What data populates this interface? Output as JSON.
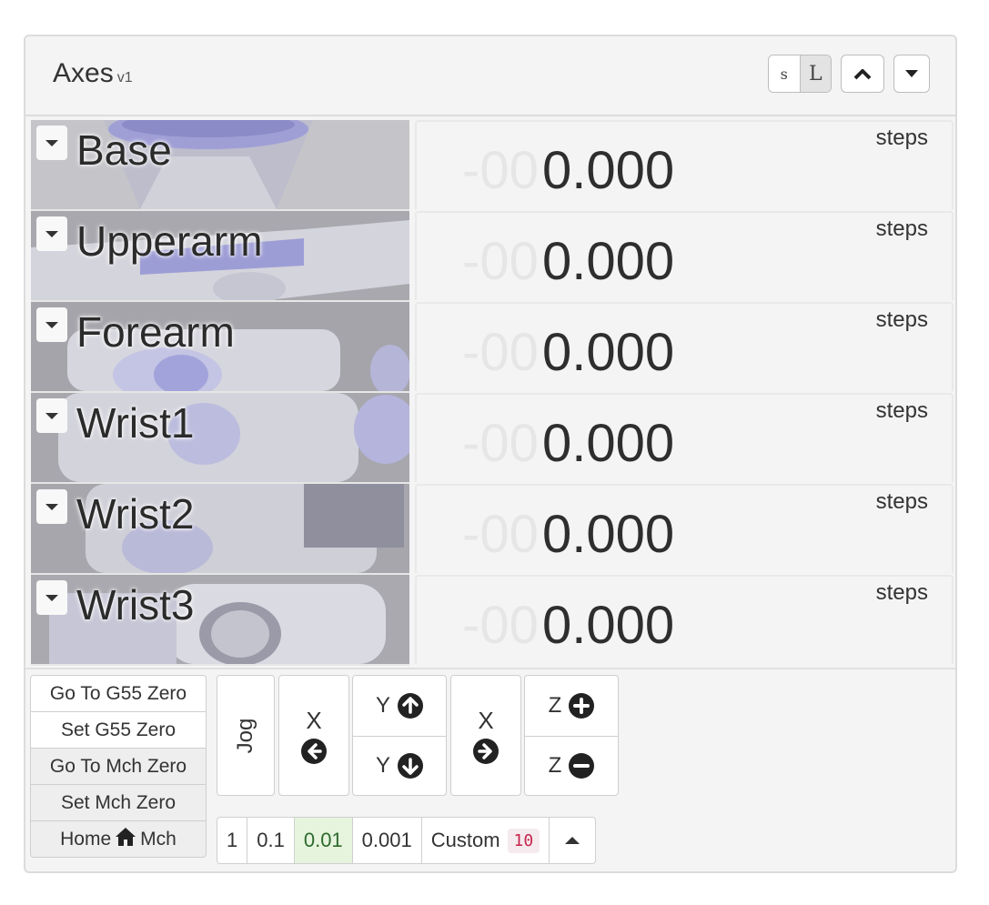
{
  "panel": {
    "title": "Axes",
    "version": "v1",
    "size_small": "s",
    "size_large": "L"
  },
  "axes": [
    {
      "name": "Base",
      "ghost": "-00",
      "value": "0.000",
      "unit": "steps"
    },
    {
      "name": "Upperarm",
      "ghost": "-00",
      "value": "0.000",
      "unit": "steps"
    },
    {
      "name": "Forearm",
      "ghost": "-00",
      "value": "0.000",
      "unit": "steps"
    },
    {
      "name": "Wrist1",
      "ghost": "-00",
      "value": "0.000",
      "unit": "steps"
    },
    {
      "name": "Wrist2",
      "ghost": "-00",
      "value": "0.000",
      "unit": "steps"
    },
    {
      "name": "Wrist3",
      "ghost": "-00",
      "value": "0.000",
      "unit": "steps"
    }
  ],
  "zero_buttons": {
    "goto_g55": "Go To G55 Zero",
    "set_g55": "Set G55 Zero",
    "goto_mch": "Go To Mch Zero",
    "set_mch": "Set Mch Zero",
    "home_prefix": "Home",
    "home_suffix": "Mch"
  },
  "jog": {
    "label": "Jog",
    "x": "X",
    "y": "Y",
    "z": "Z"
  },
  "steps": {
    "options": [
      "1",
      "0.1",
      "0.01",
      "0.001"
    ],
    "selected": "0.01",
    "custom_label": "Custom",
    "custom_value": "10"
  },
  "colors": {
    "selected_step_bg": "#e6f4dd",
    "custom_code": "#c7254e",
    "robot_tint": "#a6a6d8"
  },
  "icons": {
    "home": "home-icon",
    "arrow_left": "arrow-circle-left-icon",
    "arrow_right": "arrow-circle-right-icon",
    "arrow_up": "arrow-circle-up-icon",
    "arrow_down": "arrow-circle-down-icon",
    "plus": "plus-circle-icon",
    "minus": "minus-circle-icon"
  }
}
